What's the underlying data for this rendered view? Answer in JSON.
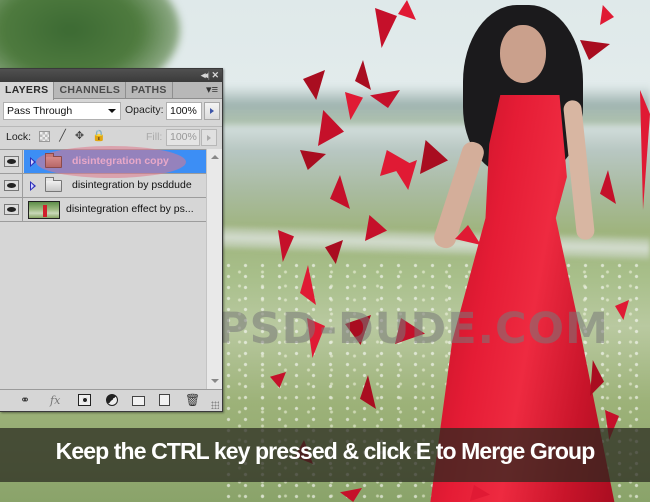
{
  "panel": {
    "tabs": [
      {
        "label": "LAYERS",
        "active": true
      },
      {
        "label": "CHANNELS",
        "active": false
      },
      {
        "label": "PATHS",
        "active": false
      }
    ],
    "title_controls": {
      "collapse": "◂◂",
      "separator": "|",
      "close": "✕"
    },
    "menu_icon": "▾≡",
    "blend_mode": "Pass Through",
    "opacity_label": "Opacity:",
    "opacity_value": "100%",
    "lock_label": "Lock:",
    "lock_icons": {
      "brush": "╱",
      "move": "✥",
      "all": "🔒"
    },
    "fill_label": "Fill:",
    "fill_value": "100%",
    "layers": [
      {
        "name": "disintegration copy",
        "type": "group",
        "selected": true,
        "visible": true,
        "folder_color": "#c77979"
      },
      {
        "name": "disintegration by psddude",
        "type": "group",
        "selected": false,
        "visible": true
      },
      {
        "name": "disintegration effect by ps...",
        "type": "image",
        "selected": false,
        "visible": true
      }
    ],
    "footer_icons": {
      "link": "⚭",
      "fx": "fx",
      "trash": "🗑"
    },
    "colors": {
      "selection": "#3c8ef5",
      "highlight": "#de788c"
    }
  },
  "watermark": "WWW.PSD-DUDE.COM",
  "caption": "Keep the CTRL key pressed & click E to Merge Group",
  "colors": {
    "dress_red": "#e51c35",
    "caption_bg": "#28281e"
  }
}
